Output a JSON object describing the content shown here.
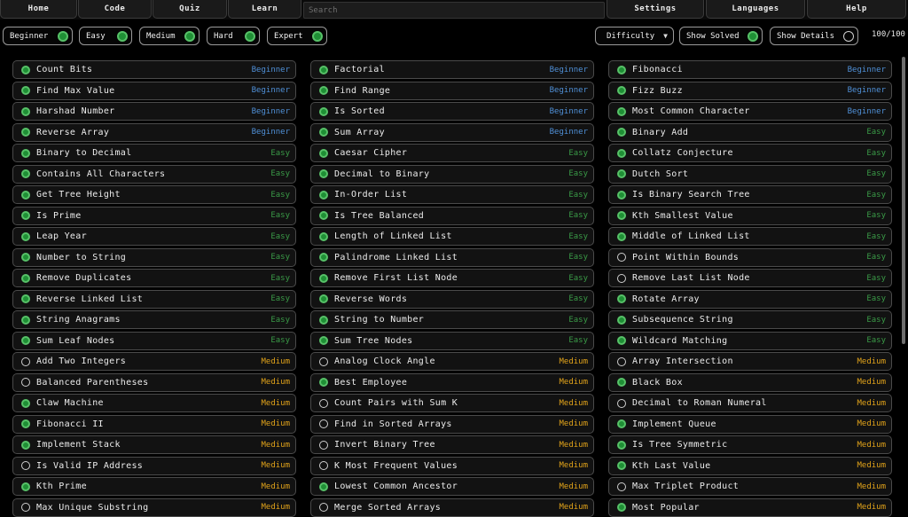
{
  "nav": {
    "home": "Home",
    "code": "Code",
    "quiz": "Quiz",
    "learn": "Learn",
    "search_placeholder": "Search",
    "settings": "Settings",
    "languages": "Languages",
    "help": "Help"
  },
  "filters": {
    "difficulties": [
      "Beginner",
      "Easy",
      "Medium",
      "Hard",
      "Expert"
    ],
    "difficulty_states": [
      true,
      true,
      true,
      true,
      true
    ],
    "difficulty_dropdown": "Difficulty",
    "show_solved": "Show Solved",
    "show_solved_state": true,
    "show_details": "Show Details",
    "show_details_state": false,
    "count": "100/100"
  },
  "colors": {
    "beginner": "#4f8fd6",
    "easy": "#3a9a47",
    "medium": "#e0a21a",
    "solved": "#57c168"
  },
  "columns": [
    [
      {
        "name": "Count Bits",
        "difficulty": "Beginner",
        "solved": true
      },
      {
        "name": "Find Max Value",
        "difficulty": "Beginner",
        "solved": true
      },
      {
        "name": "Harshad Number",
        "difficulty": "Beginner",
        "solved": true
      },
      {
        "name": "Reverse Array",
        "difficulty": "Beginner",
        "solved": true
      },
      {
        "name": "Binary to Decimal",
        "difficulty": "Easy",
        "solved": true
      },
      {
        "name": "Contains All Characters",
        "difficulty": "Easy",
        "solved": true
      },
      {
        "name": "Get Tree Height",
        "difficulty": "Easy",
        "solved": true
      },
      {
        "name": "Is Prime",
        "difficulty": "Easy",
        "solved": true
      },
      {
        "name": "Leap Year",
        "difficulty": "Easy",
        "solved": true
      },
      {
        "name": "Number to String",
        "difficulty": "Easy",
        "solved": true
      },
      {
        "name": "Remove Duplicates",
        "difficulty": "Easy",
        "solved": true
      },
      {
        "name": "Reverse Linked List",
        "difficulty": "Easy",
        "solved": true
      },
      {
        "name": "String Anagrams",
        "difficulty": "Easy",
        "solved": true
      },
      {
        "name": "Sum Leaf Nodes",
        "difficulty": "Easy",
        "solved": true
      },
      {
        "name": "Add Two Integers",
        "difficulty": "Medium",
        "solved": false
      },
      {
        "name": "Balanced Parentheses",
        "difficulty": "Medium",
        "solved": false
      },
      {
        "name": "Claw Machine",
        "difficulty": "Medium",
        "solved": true
      },
      {
        "name": "Fibonacci II",
        "difficulty": "Medium",
        "solved": true
      },
      {
        "name": "Implement Stack",
        "difficulty": "Medium",
        "solved": true
      },
      {
        "name": "Is Valid IP Address",
        "difficulty": "Medium",
        "solved": false
      },
      {
        "name": "Kth Prime",
        "difficulty": "Medium",
        "solved": true
      },
      {
        "name": "Max Unique Substring",
        "difficulty": "Medium",
        "solved": false
      }
    ],
    [
      {
        "name": "Factorial",
        "difficulty": "Beginner",
        "solved": true
      },
      {
        "name": "Find Range",
        "difficulty": "Beginner",
        "solved": true
      },
      {
        "name": "Is Sorted",
        "difficulty": "Beginner",
        "solved": true
      },
      {
        "name": "Sum Array",
        "difficulty": "Beginner",
        "solved": true
      },
      {
        "name": "Caesar Cipher",
        "difficulty": "Easy",
        "solved": true
      },
      {
        "name": "Decimal to Binary",
        "difficulty": "Easy",
        "solved": true
      },
      {
        "name": "In-Order List",
        "difficulty": "Easy",
        "solved": true
      },
      {
        "name": "Is Tree Balanced",
        "difficulty": "Easy",
        "solved": true
      },
      {
        "name": "Length of Linked List",
        "difficulty": "Easy",
        "solved": true
      },
      {
        "name": "Palindrome Linked List",
        "difficulty": "Easy",
        "solved": true
      },
      {
        "name": "Remove First List Node",
        "difficulty": "Easy",
        "solved": true
      },
      {
        "name": "Reverse Words",
        "difficulty": "Easy",
        "solved": true
      },
      {
        "name": "String to Number",
        "difficulty": "Easy",
        "solved": true
      },
      {
        "name": "Sum Tree Nodes",
        "difficulty": "Easy",
        "solved": true
      },
      {
        "name": "Analog Clock Angle",
        "difficulty": "Medium",
        "solved": false
      },
      {
        "name": "Best Employee",
        "difficulty": "Medium",
        "solved": true
      },
      {
        "name": "Count Pairs with Sum K",
        "difficulty": "Medium",
        "solved": false
      },
      {
        "name": "Find in Sorted Arrays",
        "difficulty": "Medium",
        "solved": false
      },
      {
        "name": "Invert Binary Tree",
        "difficulty": "Medium",
        "solved": false
      },
      {
        "name": "K Most Frequent Values",
        "difficulty": "Medium",
        "solved": false
      },
      {
        "name": "Lowest Common Ancestor",
        "difficulty": "Medium",
        "solved": true
      },
      {
        "name": "Merge Sorted Arrays",
        "difficulty": "Medium",
        "solved": false
      }
    ],
    [
      {
        "name": "Fibonacci",
        "difficulty": "Beginner",
        "solved": true
      },
      {
        "name": "Fizz Buzz",
        "difficulty": "Beginner",
        "solved": true
      },
      {
        "name": "Most Common Character",
        "difficulty": "Beginner",
        "solved": true
      },
      {
        "name": "Binary Add",
        "difficulty": "Easy",
        "solved": true
      },
      {
        "name": "Collatz Conjecture",
        "difficulty": "Easy",
        "solved": true
      },
      {
        "name": "Dutch Sort",
        "difficulty": "Easy",
        "solved": true
      },
      {
        "name": "Is Binary Search Tree",
        "difficulty": "Easy",
        "solved": true
      },
      {
        "name": "Kth Smallest Value",
        "difficulty": "Easy",
        "solved": true
      },
      {
        "name": "Middle of Linked List",
        "difficulty": "Easy",
        "solved": true
      },
      {
        "name": "Point Within Bounds",
        "difficulty": "Easy",
        "solved": false
      },
      {
        "name": "Remove Last List Node",
        "difficulty": "Easy",
        "solved": false
      },
      {
        "name": "Rotate Array",
        "difficulty": "Easy",
        "solved": true
      },
      {
        "name": "Subsequence String",
        "difficulty": "Easy",
        "solved": true
      },
      {
        "name": "Wildcard Matching",
        "difficulty": "Easy",
        "solved": true
      },
      {
        "name": "Array Intersection",
        "difficulty": "Medium",
        "solved": false
      },
      {
        "name": "Black Box",
        "difficulty": "Medium",
        "solved": true
      },
      {
        "name": "Decimal to Roman Numeral",
        "difficulty": "Medium",
        "solved": false
      },
      {
        "name": "Implement Queue",
        "difficulty": "Medium",
        "solved": true
      },
      {
        "name": "Is Tree Symmetric",
        "difficulty": "Medium",
        "solved": true
      },
      {
        "name": "Kth Last Value",
        "difficulty": "Medium",
        "solved": true
      },
      {
        "name": "Max Triplet Product",
        "difficulty": "Medium",
        "solved": false
      },
      {
        "name": "Most Popular",
        "difficulty": "Medium",
        "solved": true
      }
    ]
  ]
}
